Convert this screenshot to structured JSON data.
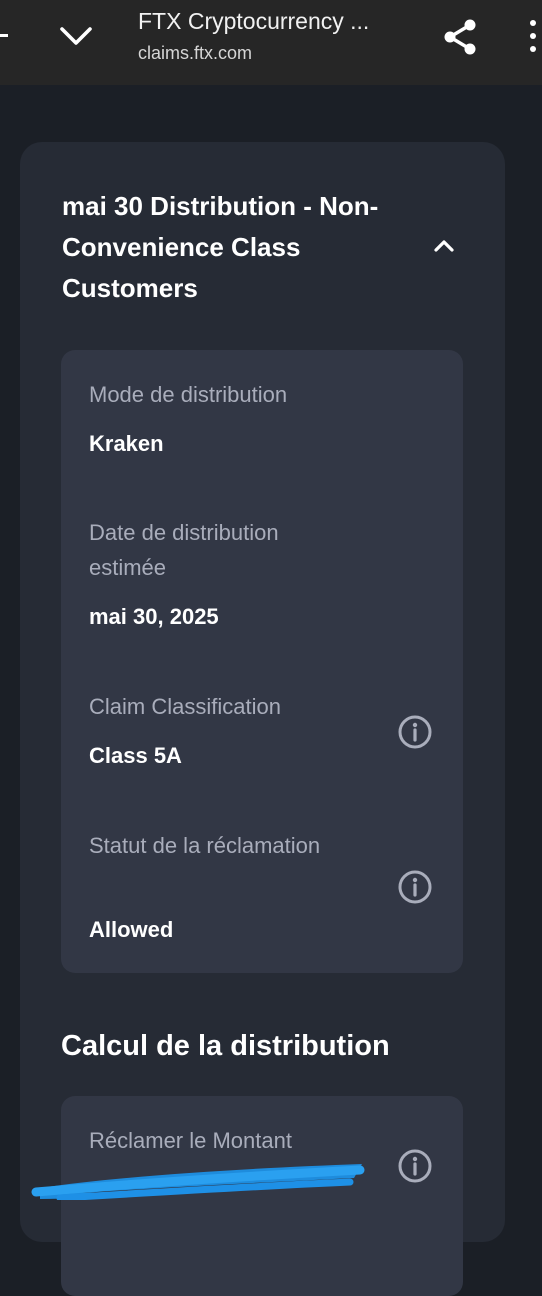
{
  "browser": {
    "page_title": "FTX Cryptocurrency ...",
    "url_host": "claims.ftx.com",
    "icons": {
      "collapse": "chevron-down-icon",
      "share": "share-icon",
      "menu": "more-vert-icon"
    }
  },
  "distribution": {
    "title": "mai 30 Distribution - Non-Convenience Class Customers",
    "fields": [
      {
        "label": "Mode de distribution",
        "value": "Kraken"
      },
      {
        "label": "Date de distribution estimée",
        "value": "mai 30, 2025"
      },
      {
        "label": "Claim Classification",
        "value": "Class 5A"
      },
      {
        "label": "Statut de la réclamation",
        "value": "Allowed"
      }
    ]
  },
  "calculation": {
    "title": "Calcul de la distribution",
    "claim_amount_label": "Réclamer le Montant"
  },
  "colors": {
    "page_background": "#1b1f26",
    "card_background": "#262b35",
    "detail_background": "#323745",
    "label_text": "#a9adbb",
    "redaction_blue": "#1e90e6"
  }
}
